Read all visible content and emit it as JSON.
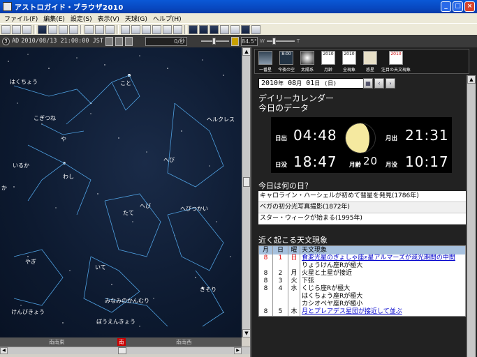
{
  "window": {
    "title": "アストロガイド・ブラウザ2010"
  },
  "menu": [
    "ファイル(F)",
    "編集(E)",
    "設定(S)",
    "表示(V)",
    "天球(G)",
    "ヘルプ(H)"
  ],
  "toolbar2": {
    "era": "AD",
    "datetime": "2010/08/13 21:00:00 JST",
    "rate": "0/秒",
    "fov": "84.5°",
    "w_label": "W",
    "t_label": "T"
  },
  "constellations": {
    "hakucho": "はくちょう",
    "koto": "こと",
    "kogitsune": "こぎつね",
    "ya": "や",
    "herakuresu": "ヘルクレス",
    "iruka": "いるか",
    "washi": "わし",
    "hebi1": "へび",
    "hebi2": "へび",
    "tate": "たて",
    "hebitsukai": "へびつかい",
    "yagi": "やぎ",
    "ite": "いて",
    "minaminokanmuri": "みなみのかんむり",
    "sasori": "さそり",
    "kenbikyou": "けんびきょう",
    "boenkyou": "ぼうえんきょう",
    "ka": "か"
  },
  "compass": {
    "left": "南南東",
    "center": "南",
    "right": "南南西"
  },
  "iconbar": [
    {
      "label": "一番星"
    },
    {
      "label": "今夜の空"
    },
    {
      "label": "太陽系"
    },
    {
      "label": "月齢"
    },
    {
      "label": "全現象"
    },
    {
      "label": "惑星"
    },
    {
      "label": "注目の天文現象"
    }
  ],
  "iconbar_years": {
    "y1": "2010",
    "y2": "2010",
    "y3": "8:00",
    "y4": "2010"
  },
  "calendar": {
    "date_year": "2010",
    "date_y": "年",
    "date_month": "08",
    "date_m": "月",
    "date_day": "01",
    "date_d": "日",
    "date_wd": "(日)"
  },
  "daily": {
    "title1": "デイリーカレンダー",
    "title2": "今日のデータ"
  },
  "sunmoon": {
    "sunrise_label": "日出",
    "sunrise": "04:48",
    "sunset_label": "日没",
    "sunset": "18:47",
    "moonrise_label": "月出",
    "moonrise": "21:31",
    "moonset_label": "月没",
    "moonset": "10:17",
    "age_label": "月齢",
    "age": "20"
  },
  "today": {
    "title": "今日は何の日？",
    "items": [
      "キャロライン・ハーシェルが初めて彗星を発見(1786年)",
      "ベガの初分光写真撮影(1872年)",
      "スター・ウィークが始まる(1995年)"
    ]
  },
  "events": {
    "title": "近く起こる天文現象",
    "headers": [
      "月",
      "日",
      "曜",
      "天文現象"
    ],
    "rows": [
      {
        "m": "8",
        "d": "1",
        "w": "日",
        "text": "食変光星のぎょしゃ座ε星アルマーズが減光期間の中間",
        "link": true,
        "red": true
      },
      {
        "m": "",
        "d": "",
        "w": "",
        "text": "りょうけん座Rが極大",
        "link": false,
        "red": false
      },
      {
        "m": "8",
        "d": "2",
        "w": "月",
        "text": "火星と土星が接近",
        "link": false,
        "red": false
      },
      {
        "m": "8",
        "d": "3",
        "w": "火",
        "text": "下弦",
        "link": false,
        "red": false
      },
      {
        "m": "8",
        "d": "4",
        "w": "水",
        "text": "くじら座Rが極大",
        "link": false,
        "red": false
      },
      {
        "m": "",
        "d": "",
        "w": "",
        "text": "はくちょう座Rが極大",
        "link": false,
        "red": false
      },
      {
        "m": "",
        "d": "",
        "w": "",
        "text": "カシオペヤ座Rが極小",
        "link": false,
        "red": false
      },
      {
        "m": "8",
        "d": "5",
        "w": "木",
        "text": "月とプレアデス星団が接近して並ぶ",
        "link": true,
        "red": false
      }
    ]
  }
}
